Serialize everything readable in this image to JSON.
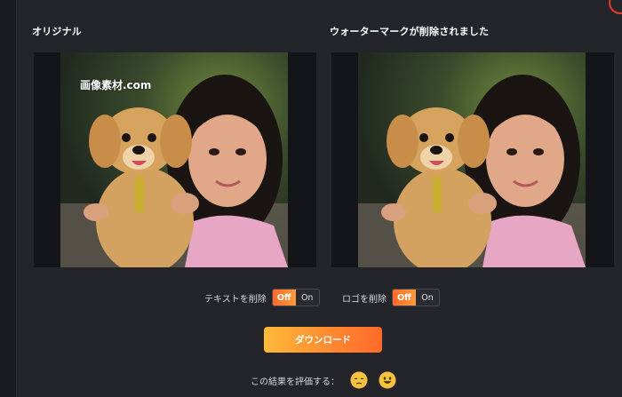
{
  "panels": {
    "original_title": "オリジナル",
    "result_title": "ウォーターマークが削除されました",
    "watermark_text": "画像素材.com"
  },
  "toggles": [
    {
      "label": "テキストを削除",
      "off_label": "Off",
      "on_label": "On",
      "state": "Off"
    },
    {
      "label": "ロゴを削除",
      "off_label": "Off",
      "on_label": "On",
      "state": "Off"
    }
  ],
  "download_label": "ダウンロード",
  "rating": {
    "label": "この結果を評価する：",
    "options": [
      "sad-face-icon",
      "happy-face-icon"
    ]
  },
  "colors": {
    "background": "#1a1b1e",
    "panel": "#24252a",
    "accent_orange": "#ff8a30",
    "accent_yellow": "#ffba3a",
    "close_badge": "#e23b2e"
  }
}
